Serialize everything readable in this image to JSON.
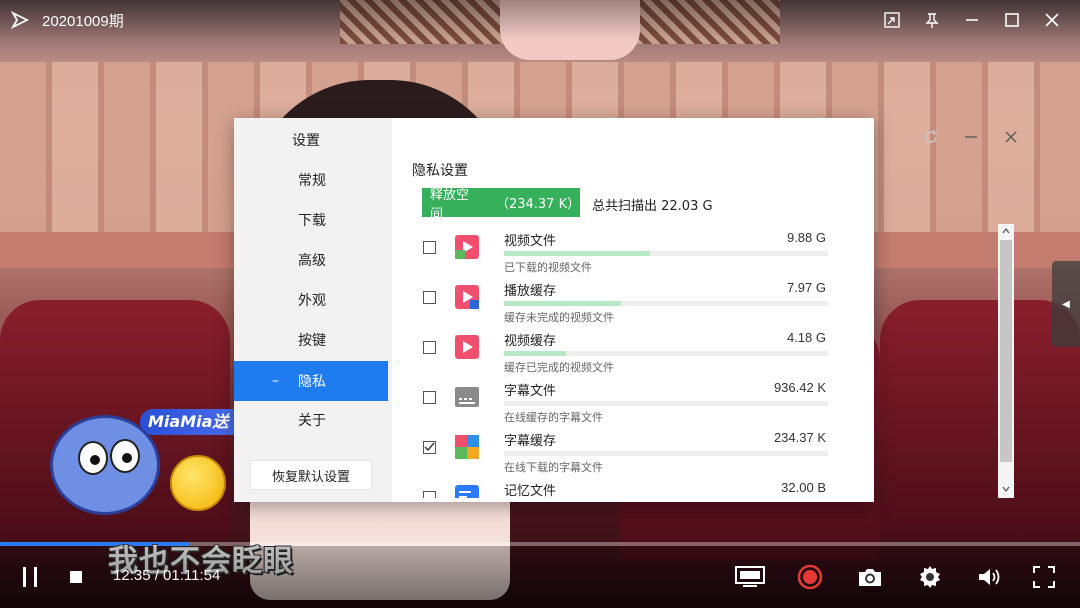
{
  "player": {
    "title": "20201009期",
    "time": "12:35 / 01:11:54",
    "progress": 0.175,
    "subtitle": "我也不会眨眼",
    "sticker_text": "MiaMia送",
    "accent": "#2b7bff"
  },
  "settings": {
    "nav_title": "设置",
    "nav": [
      {
        "label": "常规"
      },
      {
        "label": "下载"
      },
      {
        "label": "高级"
      },
      {
        "label": "外观"
      },
      {
        "label": "按键"
      },
      {
        "label": "隐私",
        "active": true,
        "marker": "–"
      },
      {
        "label": "关于"
      }
    ],
    "reset_label": "恢复默认设置",
    "section_title": "隐私设置",
    "free_button": {
      "label": "释放空间",
      "size": "（234.37 K）"
    },
    "total_scanned": "总共扫描出 22.03 G",
    "items": [
      {
        "name": "视频文件",
        "size": "9.88 G",
        "desc": "已下载的视频文件",
        "checked": false,
        "fill": 0.45,
        "icon": "video-file-icon"
      },
      {
        "name": "播放缓存",
        "size": "7.97 G",
        "desc": "缓存未完成的视频文件",
        "checked": false,
        "fill": 0.36,
        "icon": "play-cache-icon"
      },
      {
        "name": "视频缓存",
        "size": "4.18 G",
        "desc": "缓存已完成的视频文件",
        "checked": false,
        "fill": 0.19,
        "icon": "video-cache-icon"
      },
      {
        "name": "字幕文件",
        "size": "936.42 K",
        "desc": "在线缓存的字幕文件",
        "checked": false,
        "fill": 0.0,
        "icon": "subtitle-file-icon"
      },
      {
        "name": "字幕缓存",
        "size": "234.37 K",
        "desc": "在线下载的字幕文件",
        "checked": true,
        "fill": 0.0,
        "icon": "subtitle-cache-icon"
      },
      {
        "name": "记忆文件",
        "size": "32.00 B",
        "desc": "",
        "checked": false,
        "fill": 0.0,
        "icon": "memory-file-icon"
      }
    ],
    "colors": {
      "active_nav": "#1e7bf0",
      "free_button": "#36b05a",
      "bar_fill": "#b8e8c4"
    }
  }
}
